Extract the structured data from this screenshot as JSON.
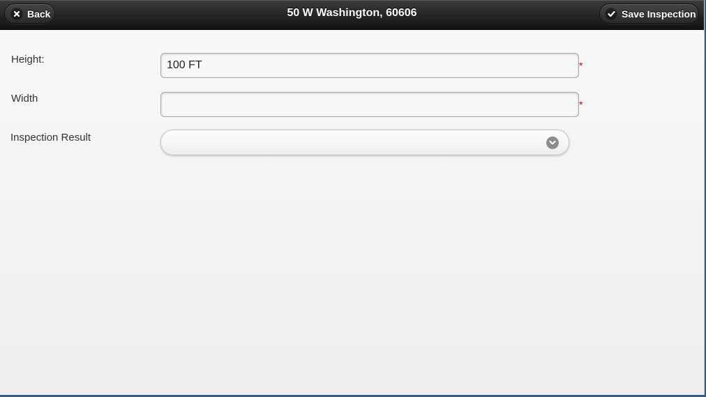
{
  "header": {
    "title": "50 W Washington, 60606",
    "back_label": "Back",
    "save_label": "Save Inspection"
  },
  "form": {
    "height": {
      "label": "Height:",
      "value": "100 FT",
      "required_marker": "*"
    },
    "width": {
      "label": "Width",
      "value": "",
      "required_marker": "*"
    },
    "inspection_result": {
      "label": "Inspection Result",
      "selected": ""
    }
  },
  "colors": {
    "header_top": "#3c3c3c",
    "header_bottom": "#111111",
    "required": "#cc0000",
    "background": "#f3f3f3"
  },
  "icons": {
    "back": "close-icon",
    "save": "check-icon",
    "select": "chevron-down-icon"
  }
}
